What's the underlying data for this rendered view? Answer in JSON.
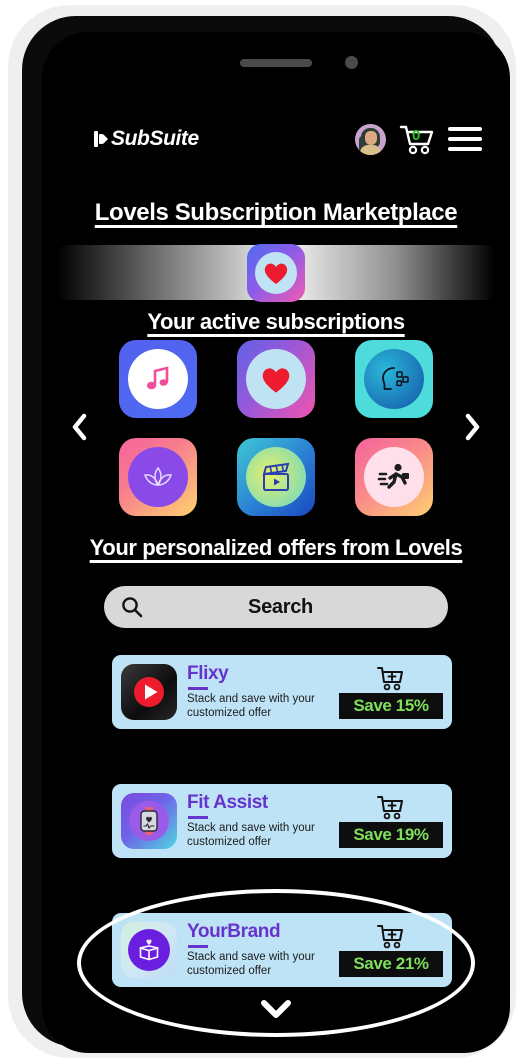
{
  "app": {
    "logo_text": "SubSuite",
    "cart_count": "0"
  },
  "titles": {
    "main": "Lovels Subscription Marketplace",
    "active_subscriptions": "Your active subscriptions",
    "offers": "Your personalized offers from Lovels"
  },
  "search": {
    "label": "Search",
    "placeholder": "Search"
  },
  "banner": {
    "icon": "heart-icon"
  },
  "carousel": {
    "prev": "chevron-left-icon",
    "next": "chevron-right-icon",
    "scroll_down": "chevron-down-icon",
    "tiles": [
      {
        "name": "music-subscription",
        "icon": "music-note-icon"
      },
      {
        "name": "dating-subscription",
        "icon": "heart-icon"
      },
      {
        "name": "audio-speech-subscription",
        "icon": "speech-head-icon"
      },
      {
        "name": "wellness-subscription",
        "icon": "lotus-icon"
      },
      {
        "name": "video-subscription",
        "icon": "clapperboard-icon"
      },
      {
        "name": "fitness-subscription",
        "icon": "running-person-icon"
      }
    ]
  },
  "offers": [
    {
      "name": "Flixy",
      "description": "Stack and save with your customized offer",
      "save_label": "Save 15%",
      "icon": "play-button-icon",
      "cart_icon": "add-to-cart-icon"
    },
    {
      "name": "Fit Assist",
      "description": "Stack and save with your customized offer",
      "save_label": "Save 19%",
      "icon": "smartwatch-icon",
      "cart_icon": "add-to-cart-icon"
    },
    {
      "name": "YourBrand",
      "description": "Stack and save with your customized offer",
      "save_label": "Save 21%",
      "icon": "gift-box-icon",
      "cart_icon": "add-to-cart-icon",
      "highlighted": true
    }
  ],
  "colors": {
    "screen_bg": "#000000",
    "card_bg": "#bfe3f6",
    "card_title": "#6633cc",
    "save_text": "#7ddf5c",
    "save_bg": "#0d0d0d",
    "cart_count": "#26c425",
    "search_bg": "#d8d8d8",
    "highlight_ring": "#ffffff"
  }
}
